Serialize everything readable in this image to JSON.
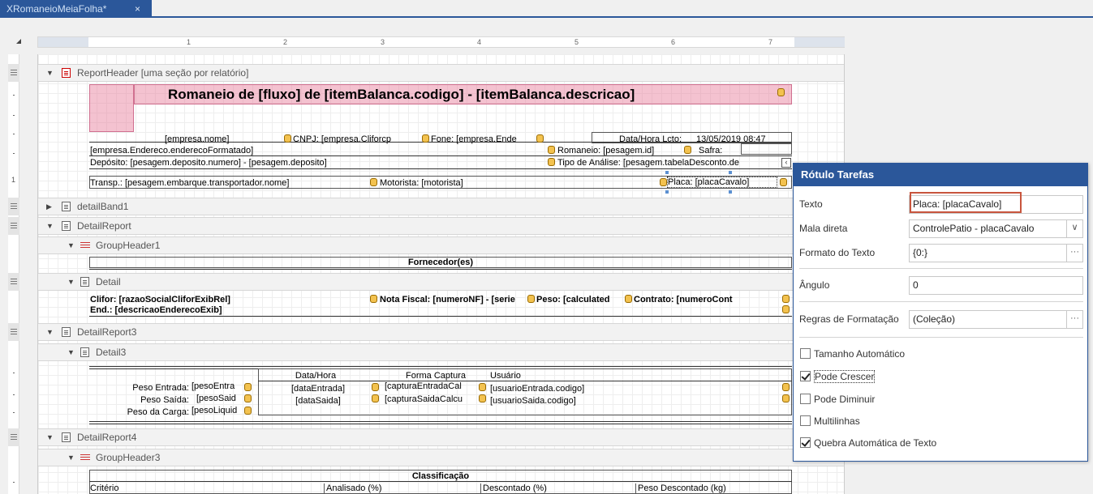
{
  "tab": {
    "title": "XRomaneioMeiaFolha*",
    "close": "×"
  },
  "ruler": {
    "n1": "1",
    "n2": "2",
    "n3": "3",
    "n4": "4",
    "n5": "5",
    "n6": "6",
    "n7": "7"
  },
  "vruler": {
    "n1": "1"
  },
  "bands": {
    "report_header": "ReportHeader [uma seção por relatório]",
    "detail_band1": "detailBand1",
    "detail_report": "DetailReport",
    "group_header1": "GroupHeader1",
    "detail": "Detail",
    "detail_report3": "DetailReport3",
    "detail3": "Detail3",
    "detail_report4": "DetailReport4",
    "group_header3": "GroupHeader3"
  },
  "header": {
    "title": "Romaneio de [fluxo] de [itemBalanca.codigo] - [itemBalanca.descricao]",
    "empresa_nome": "[empresa.nome]",
    "cnpj": "CNPJ: [empresa.Cliforcp",
    "fone": "Fone: [empresa.Ende",
    "datahora_label": "Data/Hora Lcto:",
    "datahora_value": "13/05/2019 08:47",
    "endereco": "[empresa.Endereco.enderecoFormatado]",
    "romaneio": "Romaneio: [pesagem.id]",
    "safra": "Safra:",
    "deposito": "Depósito: [pesagem.deposito.numero] - [pesagem.deposito]",
    "tipo_analise": "Tipo de Análise: [pesagem.tabelaDesconto.de",
    "transp": "Transp.: [pesagem.embarque.transportador.nome]",
    "motorista": "Motorista: [motorista]",
    "placa": "Placa: [placaCavalo]"
  },
  "group1": {
    "fornecedores": "Fornecedor(es)"
  },
  "detail": {
    "clifor": "Clifor: [razaoSocialCliforExibRel]",
    "nota": "Nota Fiscal: [numeroNF] - [serie",
    "peso": "Peso: [calculated",
    "contrato": "Contrato: [numeroCont",
    "end": "End.: [descricaoEnderecoExib]"
  },
  "detail3": {
    "col_datahora": "Data/Hora",
    "col_forma": "Forma Captura",
    "col_usuario": "Usuário",
    "peso_entrada": "Peso Entrada:",
    "peso_entrada_v": "[pesoEntra",
    "data_entrada": "[dataEntrada]",
    "captura_entrada": "[capturaEntradaCal",
    "usuario_entrada": "[usuarioEntrada.codigo]",
    "peso_saida": "Peso Saída:",
    "peso_saida_v": "[pesoSaid",
    "data_saida": "[dataSaida]",
    "captura_saida": "[capturaSaidaCalcu",
    "usuario_saida": "[usuarioSaida.codigo]",
    "peso_carga": "Peso da Carga:",
    "peso_carga_v": "[pesoLiquid"
  },
  "group3": {
    "classificacao": "Classificação",
    "criterio": "Critério",
    "analisado": "Analisado (%)",
    "descontado": "Descontado (%)",
    "peso_desc": "Peso Descontado (kg)"
  },
  "panel": {
    "title": "Rótulo Tarefas",
    "texto_label": "Texto",
    "texto_value": "Placa: [placaCavalo]",
    "mala_label": "Mala direta",
    "mala_value": "ControlePatio - placaCavalo",
    "formato_label": "Formato do Texto",
    "formato_value": "{0:}",
    "angulo_label": "Ângulo",
    "angulo_value": "0",
    "regras_label": "Regras de Formatação",
    "regras_value": "(Coleção)",
    "chk_tamanho": "Tamanho Automático",
    "chk_crescer": "Pode Crescer",
    "chk_diminuir": "Pode Diminuir",
    "chk_multilinhas": "Multilinhas",
    "chk_quebra": "Quebra Automática de Texto",
    "ellipsis": "···",
    "dropdown": "∨"
  },
  "checks": {
    "tamanho": false,
    "crescer": true,
    "diminuir": false,
    "multilinhas": false,
    "quebra": true
  },
  "colors": {
    "accent": "#2b579a",
    "highlight": "#c8553d",
    "db_icon": "#f3c24f"
  }
}
